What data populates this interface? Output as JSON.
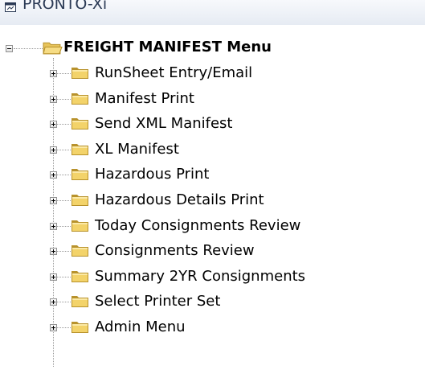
{
  "app": {
    "title": "PRONTO-Xi",
    "title_icon": "app-window-icon"
  },
  "tree": {
    "root": {
      "label": "FREIGHT MANIFEST Menu",
      "expanded": true,
      "icon": "open-folder-icon"
    },
    "children": [
      {
        "label": "RunSheet Entry/Email",
        "expanded": false,
        "icon": "folder-icon"
      },
      {
        "label": "Manifest Print",
        "expanded": false,
        "icon": "folder-icon"
      },
      {
        "label": "Send XML Manifest",
        "expanded": false,
        "icon": "folder-icon"
      },
      {
        "label": "XL Manifest",
        "expanded": false,
        "icon": "folder-icon"
      },
      {
        "label": "Hazardous Print",
        "expanded": false,
        "icon": "folder-icon"
      },
      {
        "label": "Hazardous Details Print",
        "expanded": false,
        "icon": "folder-icon"
      },
      {
        "label": "Today Consignments Review",
        "expanded": false,
        "icon": "folder-icon"
      },
      {
        "label": "Consignments Review",
        "expanded": false,
        "icon": "folder-icon"
      },
      {
        "label": "Summary 2YR Consignments",
        "expanded": false,
        "icon": "folder-icon"
      },
      {
        "label": "Select Printer Set",
        "expanded": false,
        "icon": "folder-icon"
      },
      {
        "label": "Admin Menu",
        "expanded": false,
        "icon": "folder-icon"
      }
    ]
  },
  "colors": {
    "folder_fill": "#f3d36a",
    "folder_edge": "#b8922c",
    "tree_line": "#9a9a9a",
    "header_text": "#2b3a55"
  }
}
